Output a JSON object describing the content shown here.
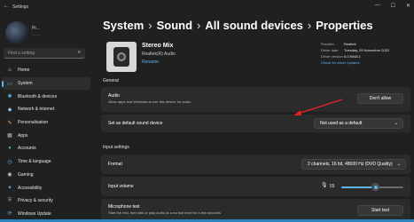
{
  "window": {
    "title": "Settings",
    "back": "←",
    "minimize": "—",
    "maximize": "☐",
    "close": "✕"
  },
  "profile": {
    "name": "Pr...",
    "email": "........."
  },
  "search": {
    "placeholder": "Find a setting"
  },
  "nav": [
    {
      "label": "Home",
      "icon": "home-icon",
      "glyph": "⌂",
      "color": "#e6e6e6"
    },
    {
      "label": "System",
      "icon": "system-icon",
      "glyph": "▭",
      "color": "#5cb6ec",
      "active": true
    },
    {
      "label": "Bluetooth & devices",
      "icon": "bluetooth-icon",
      "glyph": "✱",
      "color": "#5cb6ec"
    },
    {
      "label": "Network & internet",
      "icon": "network-icon",
      "glyph": "◆",
      "color": "#8fc7f0"
    },
    {
      "label": "Personalisation",
      "icon": "brush-icon",
      "glyph": "✎",
      "color": "#e9a86a"
    },
    {
      "label": "Apps",
      "icon": "apps-icon",
      "glyph": "▦",
      "color": "#b9b9b9"
    },
    {
      "label": "Accounts",
      "icon": "accounts-icon",
      "glyph": "●",
      "color": "#4fb28a"
    },
    {
      "label": "Time & language",
      "icon": "time-language-icon",
      "glyph": "◷",
      "color": "#5cb6ec"
    },
    {
      "label": "Gaming",
      "icon": "gaming-icon",
      "glyph": "◉",
      "color": "#c8c8c8"
    },
    {
      "label": "Accessibility",
      "icon": "accessibility-icon",
      "glyph": "✦",
      "color": "#5cb6ec"
    },
    {
      "label": "Privacy & security",
      "icon": "shield-icon",
      "glyph": "⛨",
      "color": "#9a9a9a"
    },
    {
      "label": "Windows Update",
      "icon": "windows-update-icon",
      "glyph": "⟳",
      "color": "#5cb6ec"
    }
  ],
  "breadcrumb": [
    "System",
    "Sound",
    "All sound devices",
    "Properties"
  ],
  "breadcrumb_sep": "›",
  "device": {
    "name": "Stereo Mix",
    "maker": "Realtek(R) Audio",
    "rename": "Rename",
    "meta": [
      {
        "k": "Provider",
        "v": "Realtek"
      },
      {
        "k": "Driver date",
        "v": "Tuesday, 29 November 2022"
      },
      {
        "k": "Driver version",
        "v": "6.0.9448.1"
      }
    ],
    "check_updates": "Check for driver updates"
  },
  "general": {
    "heading": "General",
    "audio_title": "Audio",
    "audio_sub": "Allow apps and Windows to use this device for audio",
    "audio_button": "Don't allow",
    "default_title": "Set as default sound device",
    "default_value": "Not used as a default"
  },
  "input": {
    "heading": "Input settings",
    "format_title": "Format",
    "format_value": "2 channels, 16 bit, 48000 Hz (DVD Quality)",
    "volume_title": "Input volume",
    "volume_value": "55",
    "volume_level": 0.55,
    "mic_title": "Microphone test",
    "mic_sub": "Start the test, then talk or play audio at a normal level for a few seconds",
    "mic_button": "Start test"
  },
  "colors": {
    "accent": "#5cb6ec",
    "annotation_arrow": "#e02424",
    "background": "#202020"
  }
}
